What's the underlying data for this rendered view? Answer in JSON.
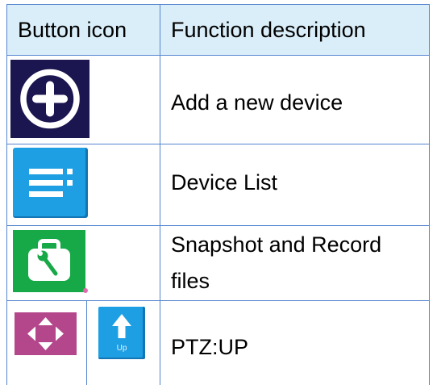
{
  "table": {
    "header": {
      "icon_column": "Button icon",
      "description_column": "Function description"
    },
    "rows": [
      {
        "icons": [
          {
            "name": "add-circle-icon",
            "color": "#1B1550"
          }
        ],
        "description_lines": [
          "Add a new device"
        ]
      },
      {
        "icons": [
          {
            "name": "device-list-icon",
            "color": "#1E9FE3"
          }
        ],
        "description_lines": [
          "Device List"
        ]
      },
      {
        "icons": [
          {
            "name": "toolbox-icon",
            "color": "#17A947"
          }
        ],
        "description_lines": [
          "Snapshot and Record",
          "files"
        ]
      },
      {
        "icons": [
          {
            "name": "ptz-direction-icon",
            "color": "#B4468C"
          },
          {
            "name": "arrow-up-icon",
            "color": "#1E9FE3",
            "label": "Up"
          }
        ],
        "description_lines": [
          "PTZ:UP"
        ]
      }
    ]
  },
  "colors": {
    "header_background": "#DAEEF9",
    "border": "#5485CF",
    "text": "#000000"
  }
}
